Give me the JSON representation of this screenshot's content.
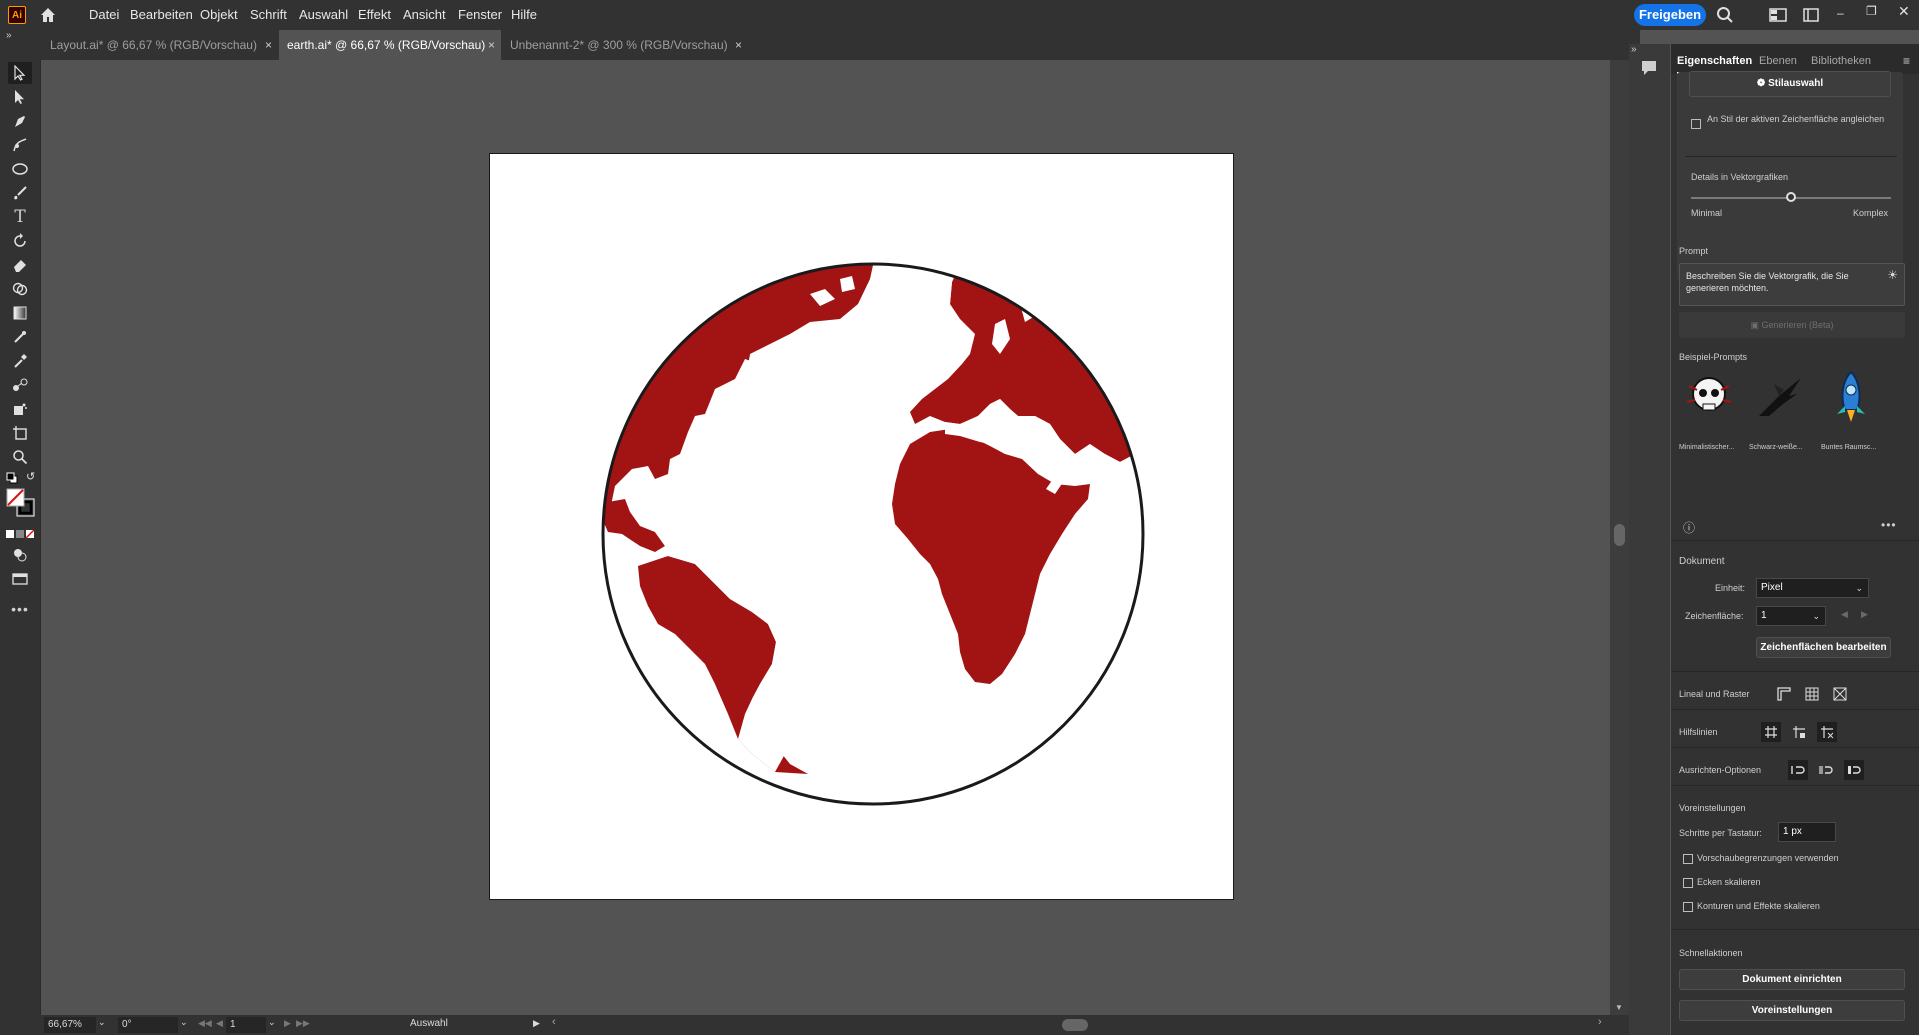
{
  "app": {
    "logo": "Ai"
  },
  "menu": [
    "Datei",
    "Bearbeiten",
    "Objekt",
    "Schrift",
    "Auswahl",
    "Effekt",
    "Ansicht",
    "Fenster",
    "Hilfe"
  ],
  "share_label": "Freigeben",
  "tabs": [
    {
      "label": "Layout.ai* @ 66,67 % (RGB/Vorschau)",
      "close": "×"
    },
    {
      "label": "earth.ai* @ 66,67 % (RGB/Vorschau)",
      "close": "×"
    },
    {
      "label": "Unbenannt-2* @ 300 % (RGB/Vorschau)",
      "close": "×"
    }
  ],
  "panel": {
    "tabs": [
      "Eigenschaften",
      "Ebenen",
      "Bibliotheken"
    ],
    "style_button": "Stilauswahl",
    "match_style_label": "An Stil der aktiven Zeichenfläche angleichen",
    "details_title": "Details in Vektorgrafiken",
    "details_level": 0.5,
    "details_min": "Minimal",
    "details_max": "Komplex",
    "prompt_title": "Prompt",
    "prompt_placeholder": "Beschreiben Sie die Vektorgrafik, die Sie generieren möchten.",
    "generate_label": "Generieren (Beta)",
    "examples_title": "Beispiel-Prompts",
    "examples": [
      "Minimalistischer...",
      "Schwarz-weiße...",
      "Buntes Raumsc..."
    ],
    "document_title": "Dokument",
    "unit_label": "Einheit:",
    "unit_value": "Pixel",
    "artboard_label": "Zeichenfläche:",
    "artboard_value": "1",
    "edit_artboards": "Zeichenflächen bearbeiten",
    "rulers_title": "Lineal und Raster",
    "guides_title": "Hilfslinien",
    "align_title": "Ausrichten-Optionen",
    "prefs_title": "Voreinstellungen",
    "keyboard_step_label": "Schritte per Tastatur:",
    "keyboard_step_value": "1 px",
    "checkboxes": [
      "Vorschaubegrenzungen verwenden",
      "Ecken skalieren",
      "Konturen und Effekte skalieren"
    ],
    "quick_actions_title": "Schnellaktionen",
    "quick_actions": [
      "Dokument einrichten",
      "Voreinstellungen"
    ]
  },
  "status": {
    "zoom": "66,67%",
    "rotation": "0°",
    "artboard": "1",
    "tool": "Auswahl"
  },
  "colors": {
    "globe_fill": "#a21414",
    "accent": "#1473e6",
    "ui_dark": "#323232",
    "canvas": "#535353"
  }
}
